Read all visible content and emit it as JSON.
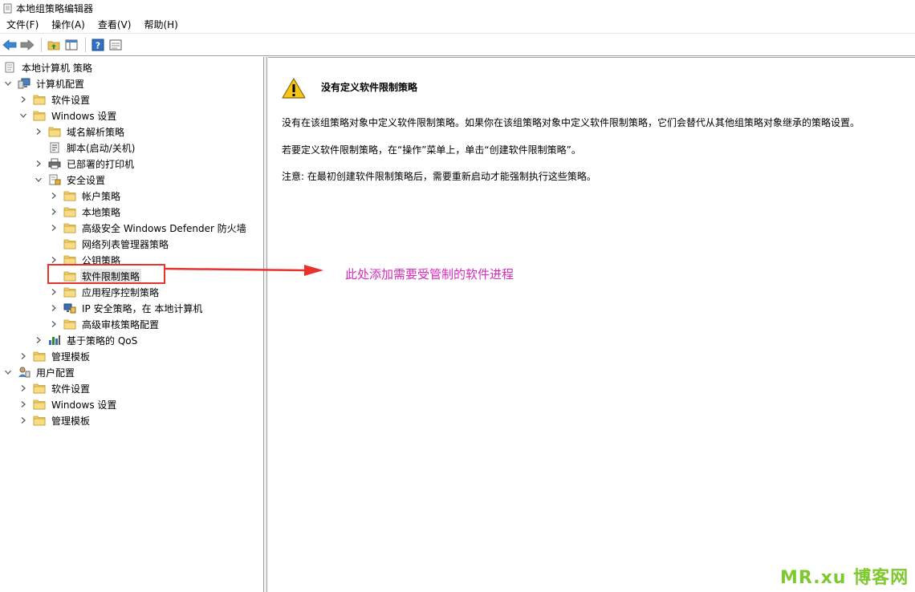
{
  "window": {
    "title": "本地组策略编辑器"
  },
  "menu": [
    "文件(F)",
    "操作(A)",
    "查看(V)",
    "帮助(H)"
  ],
  "toolbar": {
    "icons": [
      "back-arrow-icon",
      "forward-arrow-icon",
      "up-folder-icon",
      "show-hide-tree-icon",
      "help-icon",
      "properties-icon"
    ]
  },
  "tree": [
    {
      "label": "本地计算机 策略",
      "level": 0,
      "expander": "none",
      "icon": "policy-doc-icon"
    },
    {
      "label": "计算机配置",
      "level": 0,
      "expander": "open",
      "icon": "computer-icon"
    },
    {
      "label": "软件设置",
      "level": 1,
      "expander": "closed",
      "icon": "folder-icon"
    },
    {
      "label": "Windows 设置",
      "level": 1,
      "expander": "open",
      "icon": "folder-icon"
    },
    {
      "label": "域名解析策略",
      "level": 2,
      "expander": "closed",
      "icon": "folder-icon"
    },
    {
      "label": "脚本(启动/关机)",
      "level": 2,
      "expander": "none",
      "icon": "script-icon"
    },
    {
      "label": "已部署的打印机",
      "level": 2,
      "expander": "closed",
      "icon": "printer-icon"
    },
    {
      "label": "安全设置",
      "level": 2,
      "expander": "open",
      "icon": "security-settings-icon"
    },
    {
      "label": "帐户策略",
      "level": 3,
      "expander": "closed",
      "icon": "folder-icon"
    },
    {
      "label": "本地策略",
      "level": 3,
      "expander": "closed",
      "icon": "folder-icon"
    },
    {
      "label": "高级安全 Windows Defender 防火墙",
      "level": 3,
      "expander": "closed",
      "icon": "folder-icon"
    },
    {
      "label": "网络列表管理器策略",
      "level": 3,
      "expander": "none",
      "icon": "folder-icon"
    },
    {
      "label": "公钥策略",
      "level": 3,
      "expander": "closed",
      "icon": "folder-icon"
    },
    {
      "label": "软件限制策略",
      "level": 3,
      "expander": "none",
      "icon": "folder-icon",
      "selected": true
    },
    {
      "label": "应用程序控制策略",
      "level": 3,
      "expander": "closed",
      "icon": "folder-icon"
    },
    {
      "label": "IP 安全策略，在 本地计算机",
      "level": 3,
      "expander": "closed",
      "icon": "ip-security-icon"
    },
    {
      "label": "高级审核策略配置",
      "level": 3,
      "expander": "closed",
      "icon": "folder-icon"
    },
    {
      "label": "基于策略的 QoS",
      "level": 2,
      "expander": "closed",
      "icon": "qos-chart-icon"
    },
    {
      "label": "管理模板",
      "level": 1,
      "expander": "closed",
      "icon": "folder-icon"
    },
    {
      "label": "用户配置",
      "level": 0,
      "expander": "open",
      "icon": "user-icon"
    },
    {
      "label": "软件设置",
      "level": 1,
      "expander": "closed",
      "icon": "folder-icon"
    },
    {
      "label": "Windows 设置",
      "level": 1,
      "expander": "closed",
      "icon": "folder-icon"
    },
    {
      "label": "管理模板",
      "level": 1,
      "expander": "closed",
      "icon": "folder-icon"
    }
  ],
  "content": {
    "title": "没有定义软件限制策略",
    "p1": "没有在该组策略对象中定义软件限制策略。如果你在该组策略对象中定义软件限制策略，它们会替代从其他组策略对象继承的策略设置。",
    "p2": "若要定义软件限制策略，在“操作”菜单上，单击“创建软件限制策略”。",
    "p3": "注意: 在最初创建软件限制策略后，需要重新启动才能强制执行这些策略。"
  },
  "annotation": {
    "text": "此处添加需要受管制的软件进程",
    "color": "#d62bbd"
  },
  "watermark": {
    "text": "MR.xu 博客网",
    "color": "#7ec92e"
  }
}
